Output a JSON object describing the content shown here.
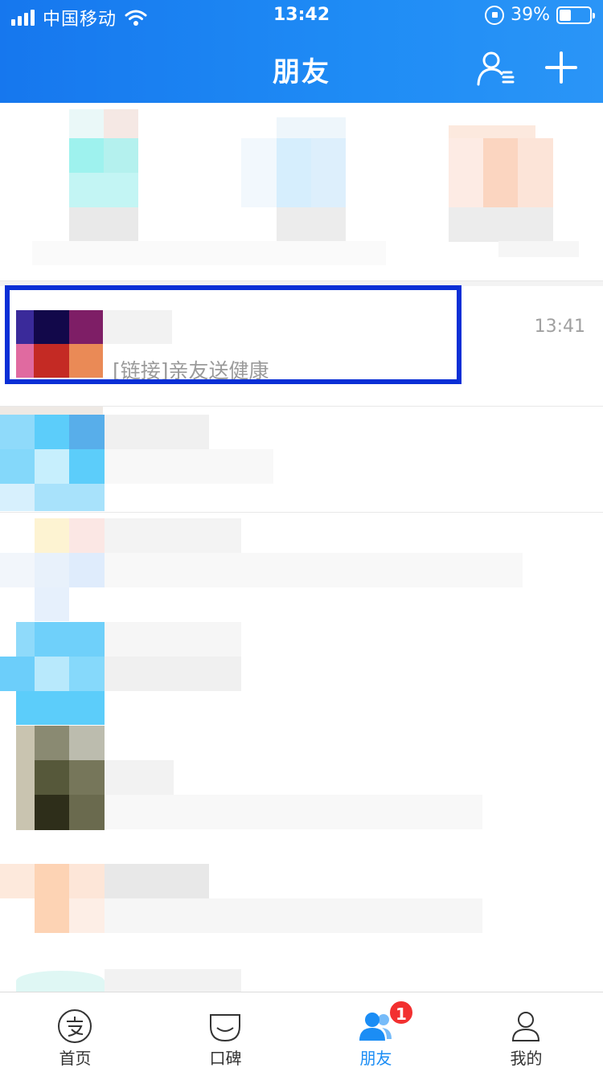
{
  "status_bar": {
    "carrier": "中国移动",
    "time": "13:42",
    "battery_percent_label": "39%",
    "battery_level": 0.39
  },
  "nav": {
    "title": "朋友"
  },
  "chat_list": [
    {
      "name": "",
      "preview": "[链接]亲友送健康",
      "time": "13:41"
    },
    {
      "name": "",
      "preview": "",
      "time": ""
    },
    {
      "name": "",
      "preview": "",
      "time": ""
    },
    {
      "name": "",
      "preview": "",
      "time": ""
    },
    {
      "name": "",
      "preview": "",
      "time": ""
    },
    {
      "name": "",
      "preview": "",
      "time": ""
    }
  ],
  "tabbar": {
    "tabs": [
      {
        "label": "首页",
        "icon": "alipay-icon"
      },
      {
        "label": "口碑",
        "icon": "koubei-icon"
      },
      {
        "label": "朋友",
        "icon": "friends-icon",
        "active": true
      },
      {
        "label": "我的",
        "icon": "profile-icon"
      }
    ],
    "friends_badge": "1"
  },
  "colors": {
    "header_blue": "#1677ee",
    "active_tab": "#1b8df5",
    "badge_red": "#f23030",
    "highlight_box": "#0a2fd6"
  }
}
